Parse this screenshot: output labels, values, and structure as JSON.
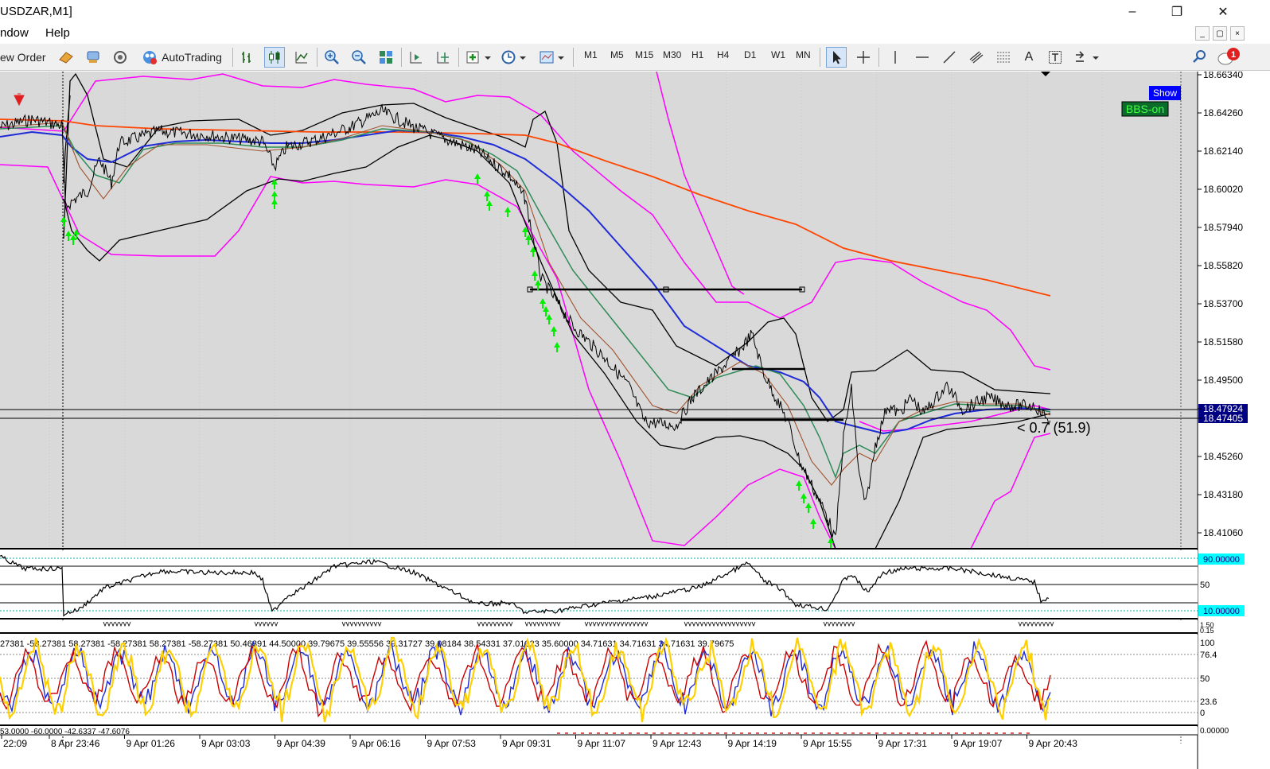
{
  "window": {
    "title": "USDZAR,M1]"
  },
  "menu": {
    "items": [
      "ndow",
      "Help"
    ]
  },
  "toolbar": {
    "new_order": "ew Order",
    "autotrading": "AutoTrading",
    "timeframes": [
      "M1",
      "M5",
      "M15",
      "M30",
      "H1",
      "H4",
      "D1",
      "W1",
      "MN"
    ],
    "text_tool": "A",
    "notification_count": "1"
  },
  "chart": {
    "price_labels": [
      "18.66340",
      "18.64260",
      "18.62140",
      "18.60020",
      "18.57940",
      "18.55820",
      "18.53700",
      "18.51580",
      "18.49500",
      "18.47924",
      "18.47405",
      "18.45260",
      "18.43180",
      "18.41060"
    ],
    "time_labels": [
      "22:09",
      "8 Apr 23:46",
      "9 Apr 01:26",
      "9 Apr 03:03",
      "9 Apr 04:39",
      "9 Apr 06:16",
      "9 Apr 07:53",
      "9 Apr 09:31",
      "9 Apr 11:07",
      "9 Apr 12:43",
      "9 Apr 14:19",
      "9 Apr 15:55",
      "9 Apr 17:31",
      "9 Apr 19:07",
      "9 Apr 20:43"
    ],
    "show_button": "Show",
    "bbs_label": "BBS-on",
    "annotation": "< 0.7 (51.9)",
    "colors": {
      "bollinger": "#ff00ff",
      "ma_long": "#ff4500",
      "ma_blue": "#1e2bd6",
      "ma_green": "#2e8b57",
      "price": "#000000",
      "arrows": "#00ee00",
      "show_bg": "#0000ff",
      "bbs_bg": "#0a6b2b",
      "bbs_text": "#44ff44",
      "highlight_label": "#000080"
    }
  },
  "rsi": {
    "scale_labels": [
      "50"
    ],
    "high_level": "90.00000",
    "low_level": "10.00000"
  },
  "mini_panel": {
    "scale_labels": [
      "1.50",
      "0.15"
    ]
  },
  "stoch": {
    "header": "27381 -58.27381 58.27381 -58.27381 58.27381 -58.27381 50.46391 44.50000 39.79675 39.55556 39.31727 39.08184 38.54331 37.01323 35.60000 34.71631 34.71631 34.71631 39.79675",
    "scale_labels": [
      "100",
      "76.4",
      "50",
      "23.6",
      "0"
    ],
    "colors": [
      "#1f2bd6",
      "#ffd000",
      "#cc0000"
    ]
  },
  "bottom_panel": {
    "header": "53.0000 -60.0000 -42.6337 -47.6076",
    "scale_label": "0.00000"
  }
}
